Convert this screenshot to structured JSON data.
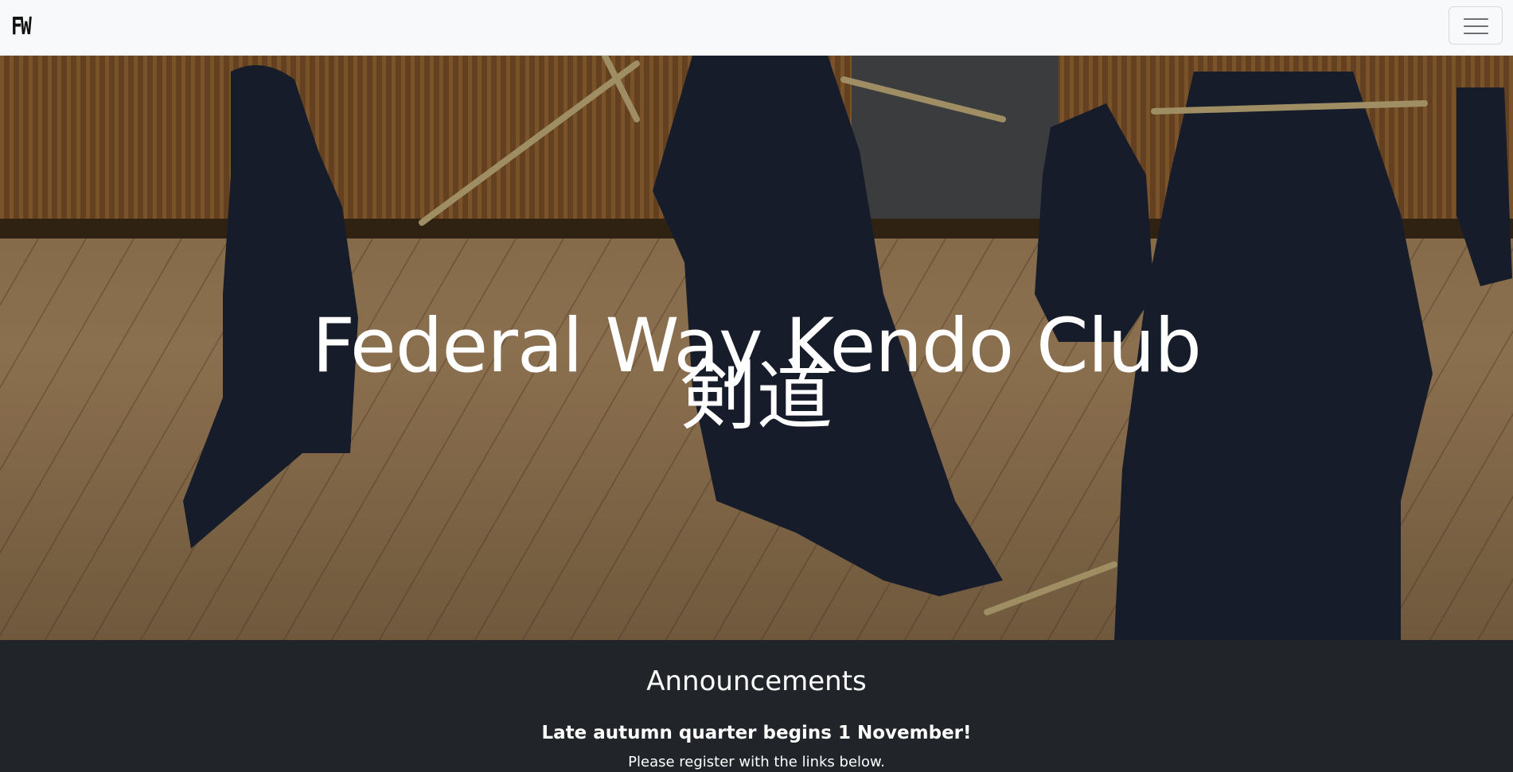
{
  "navbar": {
    "brand": "FW",
    "toggler_icon": "hamburger-menu-icon",
    "background": "#f8f9fa"
  },
  "hero": {
    "title": "Federal Way Kendo Club",
    "subtitle": "剣道"
  },
  "announcements": {
    "heading": "Announcements",
    "headline": "Late autumn quarter begins 1 November!",
    "text": "Please register with the links below.",
    "background": "#212529"
  }
}
